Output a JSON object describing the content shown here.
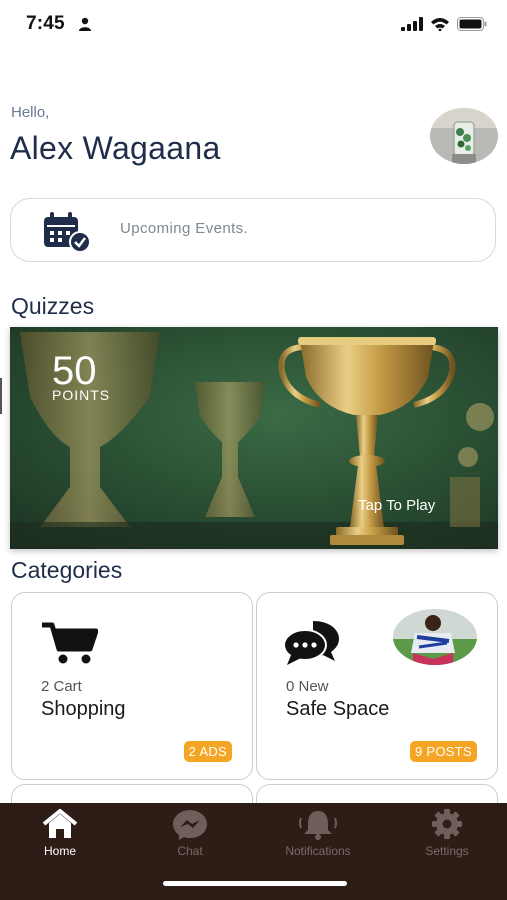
{
  "status_bar": {
    "time": "7:45"
  },
  "greeting": {
    "hello": "Hello,",
    "name": "Alex Wagaana"
  },
  "events": {
    "label": "Upcoming Events."
  },
  "quizzes": {
    "title": "Quizzes",
    "points": "50",
    "points_label": "POINTS",
    "cta": "Tap To Play"
  },
  "categories": {
    "title": "Categories",
    "items": [
      {
        "subtitle": "2 Cart",
        "title": "Shopping",
        "badge": "2 ADS",
        "icon": "cart-icon"
      },
      {
        "subtitle": "0 New",
        "title": "Safe Space",
        "badge": "9 POSTS",
        "icon": "chat-bubbles-icon"
      }
    ]
  },
  "colors": {
    "accent": "#f5a524",
    "nav_bg": "#2e1c17",
    "heading": "#1f2d4a"
  },
  "nav": {
    "items": [
      {
        "label": "Home",
        "icon": "home-icon",
        "active": true
      },
      {
        "label": "Chat",
        "icon": "messenger-icon",
        "active": false
      },
      {
        "label": "Notifications",
        "icon": "bell-icon",
        "active": false
      },
      {
        "label": "Settings",
        "icon": "gear-icon",
        "active": false
      }
    ]
  }
}
